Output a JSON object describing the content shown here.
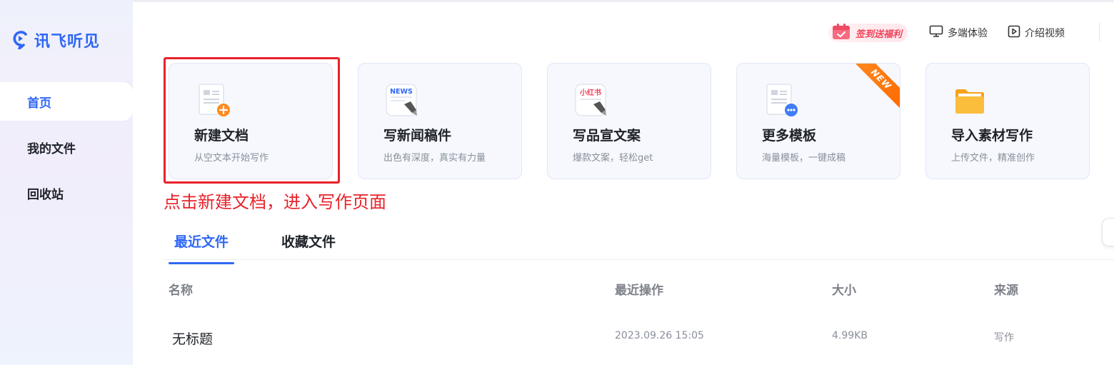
{
  "brand": {
    "name": "讯飞听见"
  },
  "sidebar": {
    "items": [
      {
        "label": "首页",
        "active": true
      },
      {
        "label": "我的文件",
        "active": false
      },
      {
        "label": "回收站",
        "active": false
      }
    ]
  },
  "header": {
    "signin_label": "签到送福利",
    "multi_device_label": "多端体验",
    "intro_video_label": "介绍视频"
  },
  "cards": [
    {
      "title": "新建文档",
      "subtitle": "从空文本开始写作",
      "icon": "new-doc-icon"
    },
    {
      "title": "写新闻稿件",
      "subtitle": "出色有深度，真实有力量",
      "icon": "news-icon",
      "icon_text": "NEWS"
    },
    {
      "title": "写品宣文案",
      "subtitle": "爆款文案，轻松get",
      "icon": "xiaohongshu-icon",
      "icon_text": "小红书"
    },
    {
      "title": "更多模板",
      "subtitle": "海量模板，一键成稿",
      "icon": "template-icon",
      "badge": "NEW"
    },
    {
      "title": "导入素材写作",
      "subtitle": "上传文件，精准创作",
      "icon": "folder-icon"
    }
  ],
  "annotation": "点击新建文档，进入写作页面",
  "tabs": [
    {
      "label": "最近文件",
      "active": true
    },
    {
      "label": "收藏文件",
      "active": false
    }
  ],
  "table": {
    "columns": [
      "名称",
      "最近操作",
      "大小",
      "来源"
    ],
    "rows": [
      {
        "name": "无标题",
        "last_op": "2023.09.26 15:05",
        "size": "4.99KB",
        "source": "写作"
      }
    ]
  },
  "colors": {
    "accent": "#2f67f6",
    "annotation": "#e8222b",
    "badge": "#ff7a0f"
  }
}
